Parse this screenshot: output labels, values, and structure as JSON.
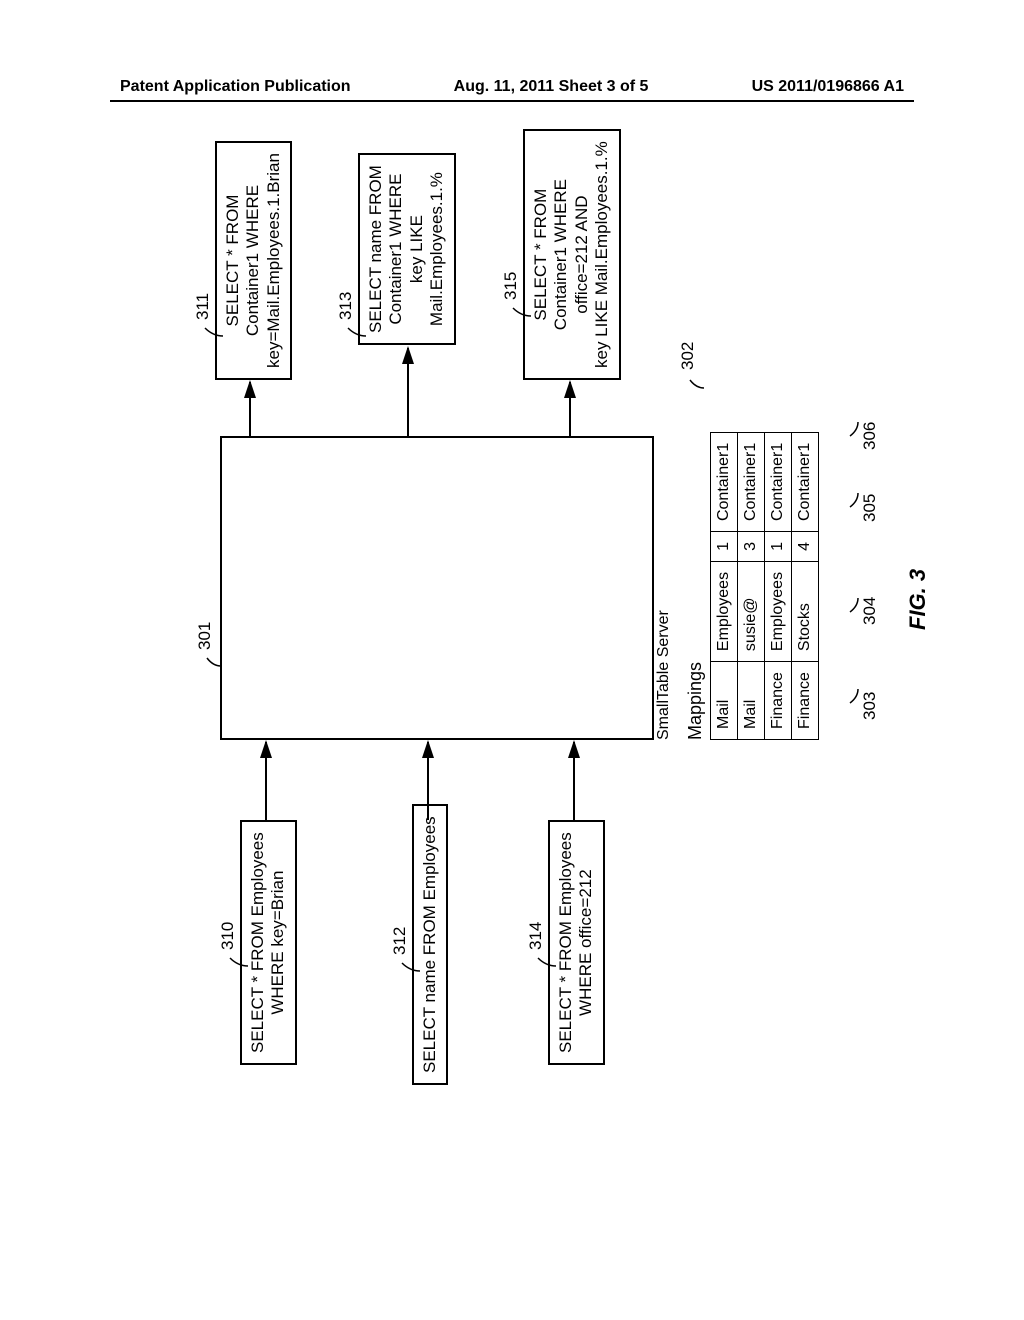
{
  "header": {
    "left": "Patent Application Publication",
    "center": "Aug. 11, 2011  Sheet 3 of 5",
    "right": "US 2011/0196866 A1"
  },
  "queries": {
    "q310": [
      "SELECT * FROM Employees",
      "WHERE key=Brian"
    ],
    "q312": [
      "SELECT name FROM Employees"
    ],
    "q314": [
      "SELECT * FROM Employees",
      "WHERE office=212"
    ],
    "q311": [
      "SELECT * FROM",
      "Container1 WHERE",
      "key=Mail.Employees.1.Brian"
    ],
    "q313": [
      "SELECT name FROM",
      "Container1 WHERE",
      "key LIKE",
      "Mail.Employees.1.%"
    ],
    "q315": [
      "SELECT * FROM",
      "Container1 WHERE",
      "office=212 AND",
      "key LIKE Mail.Employees.1.%"
    ]
  },
  "refs": {
    "r310": "310",
    "r312": "312",
    "r314": "314",
    "r311": "311",
    "r313": "313",
    "r315": "315",
    "r301": "301",
    "r302": "302",
    "r303": "303",
    "r304": "304",
    "r305": "305",
    "r306": "306"
  },
  "labels": {
    "server": "SmallTable Server",
    "mappings": "Mappings",
    "figtitle": "FIG. 3"
  },
  "mappings_table": {
    "rows": [
      [
        "Mail",
        "Employees",
        "1",
        "Container1"
      ],
      [
        "Mail",
        "susie@",
        "3",
        "Container1"
      ],
      [
        "Finance",
        "Employees",
        "1",
        "Container1"
      ],
      [
        "Finance",
        "Stocks",
        "4",
        "Container1"
      ]
    ]
  }
}
